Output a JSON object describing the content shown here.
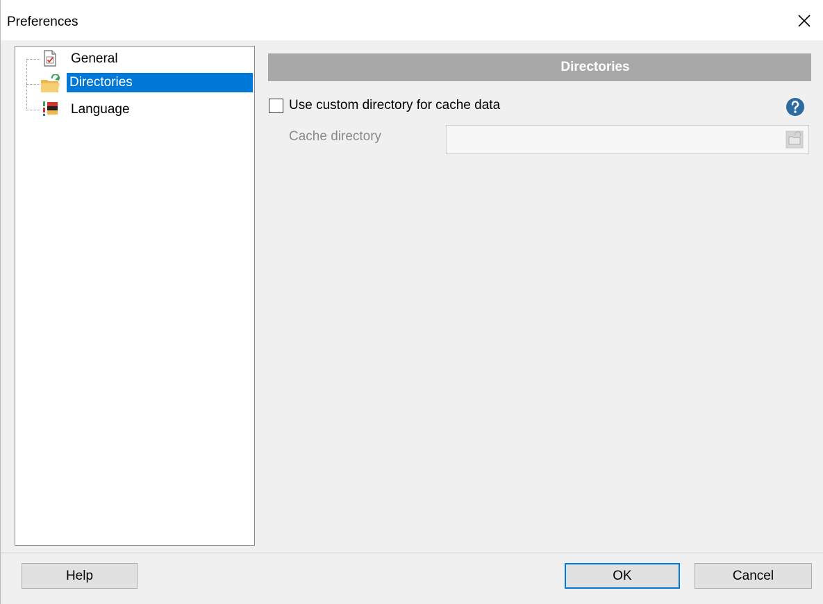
{
  "window": {
    "title": "Preferences"
  },
  "tree": {
    "items": [
      {
        "label": "General",
        "icon": "checklist-document-icon",
        "selected": false
      },
      {
        "label": "Directories",
        "icon": "folder-refresh-icon",
        "selected": true
      },
      {
        "label": "Language",
        "icon": "language-flags-icon",
        "selected": false
      }
    ]
  },
  "section": {
    "header": "Directories"
  },
  "cache": {
    "checkbox_label": "Use custom directory for cache data",
    "checked": false,
    "field_label": "Cache directory",
    "field_value": ""
  },
  "buttons": {
    "help": "Help",
    "ok": "OK",
    "cancel": "Cancel"
  },
  "colors": {
    "selection": "#0078d7",
    "header_bg": "#a8a8a8",
    "help_icon": "#2d6a9f"
  }
}
